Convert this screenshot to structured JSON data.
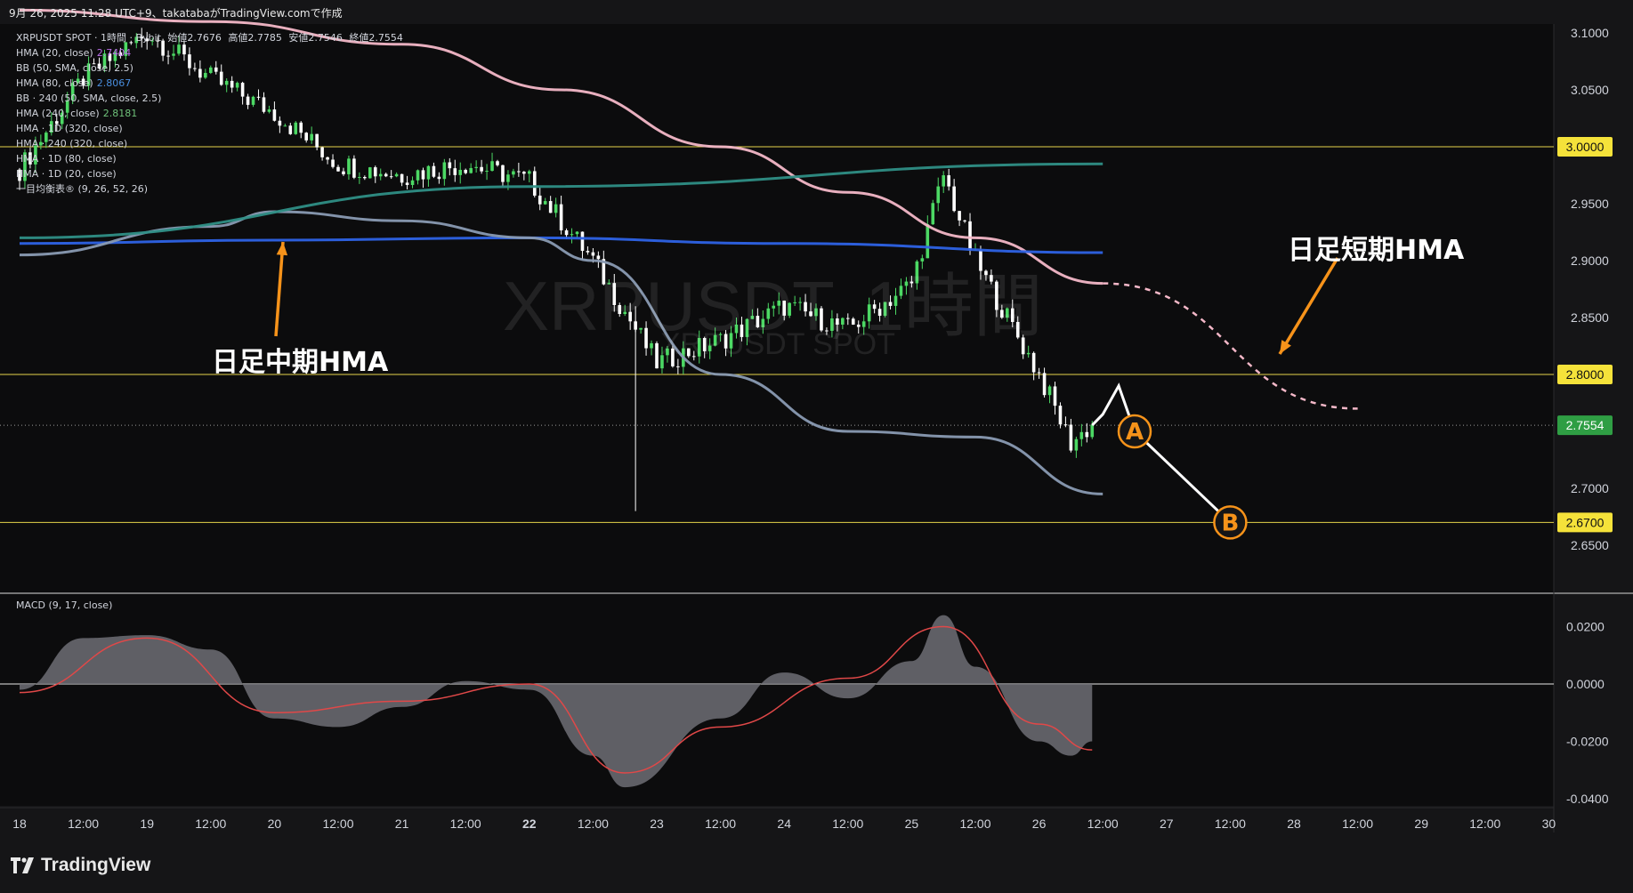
{
  "header": {
    "caption": "9月 26, 2025 11:28 UTC+9、takatabaがTradingView.comで作成"
  },
  "legend": [
    {
      "label": "XRPUSDT SPOT · 1時間 · Bybit",
      "ohlc": {
        "o_label": "始値",
        "o": "2.7676",
        "h_label": "高値",
        "h": "2.7785",
        "l_label": "安値",
        "l": "2.7546",
        "c_label": "終値",
        "c": "2.7554"
      }
    },
    {
      "label": "HMA (20, close)",
      "value": "2.7404",
      "color": "#b96ee6"
    },
    {
      "label": "BB (50, SMA, close, 2.5)",
      "value": "",
      "color": "#d1d4dc"
    },
    {
      "label": "HMA (80, close)",
      "value": "2.8067",
      "color": "#4a8fe0"
    },
    {
      "label": "BB · 240 (50, SMA, close, 2.5)",
      "value": "",
      "color": "#d1d4dc"
    },
    {
      "label": "HMA (240, close)",
      "value": "2.8181",
      "color": "#6fc27a"
    },
    {
      "label": "HMA · 1D (320, close)",
      "value": "",
      "color": "#d1d4dc"
    },
    {
      "label": "HMA · 240 (320, close)",
      "value": "",
      "color": "#d1d4dc"
    },
    {
      "label": "HMA · 1D (80, close)",
      "value": "",
      "color": "#d1d4dc"
    },
    {
      "label": "HMA · 1D (20, close)",
      "value": "",
      "color": "#d1d4dc"
    },
    {
      "label": "一目均衡表® (9, 26, 52, 26)",
      "value": "",
      "color": "#d1d4dc"
    }
  ],
  "watermark": {
    "main": "XRPUSDT, 1時間",
    "sub": "XRPUSDT SPOT"
  },
  "annotations": {
    "mid_hma": "日足中期HMA",
    "short_hma": "日足短期HMA",
    "point_a": "A",
    "point_b": "B"
  },
  "macd_legend": "MACD (9, 17, close)",
  "footer": {
    "brand": "TradingView"
  },
  "colors": {
    "background": "#151517",
    "candle_up": "#4cd964",
    "candle_down": "#ffffff",
    "hline": "#e6d44a",
    "last_price_bg": "#2f9e44",
    "annotation_arrow": "#f7931a",
    "hma_pink": "#f4b8c8",
    "hma_blue_thick": "#2e63e6",
    "hma_teal": "#2f8f86",
    "hma_gray": "#8a9bb3"
  },
  "chart_data": [
    {
      "type": "candlestick",
      "title": "XRPUSDT, 1時間",
      "x_ticks": [
        "18",
        "12:00",
        "19",
        "12:00",
        "20",
        "12:00",
        "21",
        "12:00",
        "22",
        "12:00",
        "23",
        "12:00",
        "24",
        "12:00",
        "25",
        "12:00",
        "26",
        "12:00",
        "27",
        "12:00",
        "28",
        "12:00",
        "29",
        "12:00",
        "30"
      ],
      "y_ticks": [
        "3.1000",
        "3.0500",
        "3.0000",
        "2.9500",
        "2.9000",
        "2.8500",
        "2.8000",
        "2.7500",
        "2.7000",
        "2.6500"
      ],
      "ylim": [
        2.63,
        3.11
      ],
      "horizontal_levels": [
        {
          "value": 3.0,
          "label": "3.0000"
        },
        {
          "value": 2.8,
          "label": "2.8000"
        },
        {
          "value": 2.67,
          "label": "2.6700"
        }
      ],
      "last_price": {
        "value": 2.7554,
        "label": "2.7554"
      },
      "close_path": [
        {
          "x": "18 00:00",
          "y": 2.98
        },
        {
          "x": "18 12:00",
          "y": 3.06
        },
        {
          "x": "19 00:00",
          "y": 3.1
        },
        {
          "x": "19 12:00",
          "y": 3.06
        },
        {
          "x": "20 00:00",
          "y": 3.03
        },
        {
          "x": "20 12:00",
          "y": 2.985
        },
        {
          "x": "21 00:00",
          "y": 2.975
        },
        {
          "x": "21 12:00",
          "y": 2.985
        },
        {
          "x": "22 00:00",
          "y": 2.97
        },
        {
          "x": "22 12:00",
          "y": 2.9
        },
        {
          "x": "23 00:00",
          "y": 2.81
        },
        {
          "x": "23 12:00",
          "y": 2.83
        },
        {
          "x": "24 00:00",
          "y": 2.86
        },
        {
          "x": "24 12:00",
          "y": 2.84
        },
        {
          "x": "25 00:00",
          "y": 2.88
        },
        {
          "x": "25 06:00",
          "y": 2.975
        },
        {
          "x": "25 12:00",
          "y": 2.9
        },
        {
          "x": "26 00:00",
          "y": 2.8
        },
        {
          "x": "26 06:00",
          "y": 2.74
        },
        {
          "x": "26 10:00",
          "y": 2.7554
        }
      ],
      "projection": [
        {
          "x": "26 12:00",
          "y": 2.765
        },
        {
          "x": "26 15:00",
          "y": 2.79
        },
        {
          "x": "26 18:00",
          "y": 2.75,
          "label": "A"
        },
        {
          "x": "27 12:00",
          "y": 2.67,
          "label": "B"
        }
      ],
      "series": [
        {
          "name": "HMA · 1D (20, close)",
          "color": "#f4b8c8",
          "points": [
            {
              "x": "18 00:00",
              "y": 3.12
            },
            {
              "x": "19 12:00",
              "y": 3.11
            },
            {
              "x": "21 00:00",
              "y": 3.09
            },
            {
              "x": "22 06:00",
              "y": 3.05
            },
            {
              "x": "23 12:00",
              "y": 3.0
            },
            {
              "x": "24 12:00",
              "y": 2.96
            },
            {
              "x": "25 12:00",
              "y": 2.92
            },
            {
              "x": "26 12:00",
              "y": 2.88
            }
          ],
          "extension": [
            {
              "x": "26 12:00",
              "y": 2.88
            },
            {
              "x": "28 12:00",
              "y": 2.77
            }
          ]
        },
        {
          "name": "HMA · 1D (80, close)",
          "color": "#2e63e6",
          "points": [
            {
              "x": "18 00:00",
              "y": 2.915
            },
            {
              "x": "20 00:00",
              "y": 2.918
            },
            {
              "x": "22 00:00",
              "y": 2.92
            },
            {
              "x": "24 00:00",
              "y": 2.915
            },
            {
              "x": "26 12:00",
              "y": 2.907
            }
          ]
        },
        {
          "name": "HMA · 240 (320, close)",
          "color": "#8a9bb3",
          "points": [
            {
              "x": "18 00:00",
              "y": 2.905
            },
            {
              "x": "19 12:00",
              "y": 2.93
            },
            {
              "x": "20 00:00",
              "y": 2.943
            },
            {
              "x": "21 00:00",
              "y": 2.935
            },
            {
              "x": "22 00:00",
              "y": 2.92
            },
            {
              "x": "22 12:00",
              "y": 2.9
            },
            {
              "x": "23 12:00",
              "y": 2.8
            },
            {
              "x": "24 12:00",
              "y": 2.75
            },
            {
              "x": "25 12:00",
              "y": 2.745
            },
            {
              "x": "26 12:00",
              "y": 2.695
            }
          ]
        },
        {
          "name": "HMA · 1D (320, close)",
          "color": "#2f8f86",
          "points": [
            {
              "x": "18 00:00",
              "y": 2.92
            },
            {
              "x": "22 00:00",
              "y": 2.965
            },
            {
              "x": "26 12:00",
              "y": 2.985
            }
          ]
        }
      ]
    },
    {
      "type": "area",
      "title": "MACD (9, 17, close)",
      "y_ticks": [
        "0.0200",
        "0.0000",
        "-0.0200",
        "-0.0400"
      ],
      "ylim": [
        -0.045,
        0.025
      ],
      "series": [
        {
          "name": "MACD",
          "color": "#6e6e75",
          "points": [
            {
              "x": "18 00:00",
              "y": -0.002
            },
            {
              "x": "18 12:00",
              "y": 0.016
            },
            {
              "x": "19 00:00",
              "y": 0.017
            },
            {
              "x": "19 12:00",
              "y": 0.012
            },
            {
              "x": "20 00:00",
              "y": -0.012
            },
            {
              "x": "20 12:00",
              "y": -0.015
            },
            {
              "x": "21 00:00",
              "y": -0.008
            },
            {
              "x": "21 12:00",
              "y": 0.001
            },
            {
              "x": "22 00:00",
              "y": -0.002
            },
            {
              "x": "22 12:00",
              "y": -0.025
            },
            {
              "x": "22 18:00",
              "y": -0.036
            },
            {
              "x": "23 12:00",
              "y": -0.012
            },
            {
              "x": "24 00:00",
              "y": 0.004
            },
            {
              "x": "24 12:00",
              "y": -0.005
            },
            {
              "x": "25 00:00",
              "y": 0.008
            },
            {
              "x": "25 06:00",
              "y": 0.024
            },
            {
              "x": "25 12:00",
              "y": 0.006
            },
            {
              "x": "26 00:00",
              "y": -0.02
            },
            {
              "x": "26 06:00",
              "y": -0.025
            },
            {
              "x": "26 10:00",
              "y": -0.02
            }
          ]
        },
        {
          "name": "Signal",
          "color": "#e04848",
          "points": [
            {
              "x": "18 00:00",
              "y": -0.003
            },
            {
              "x": "19 00:00",
              "y": 0.016
            },
            {
              "x": "20 00:00",
              "y": -0.01
            },
            {
              "x": "21 00:00",
              "y": -0.006
            },
            {
              "x": "22 00:00",
              "y": 0.0
            },
            {
              "x": "22 18:00",
              "y": -0.031
            },
            {
              "x": "23 12:00",
              "y": -0.015
            },
            {
              "x": "24 12:00",
              "y": 0.002
            },
            {
              "x": "25 06:00",
              "y": 0.02
            },
            {
              "x": "26 00:00",
              "y": -0.014
            },
            {
              "x": "26 10:00",
              "y": -0.023
            }
          ]
        }
      ]
    }
  ]
}
